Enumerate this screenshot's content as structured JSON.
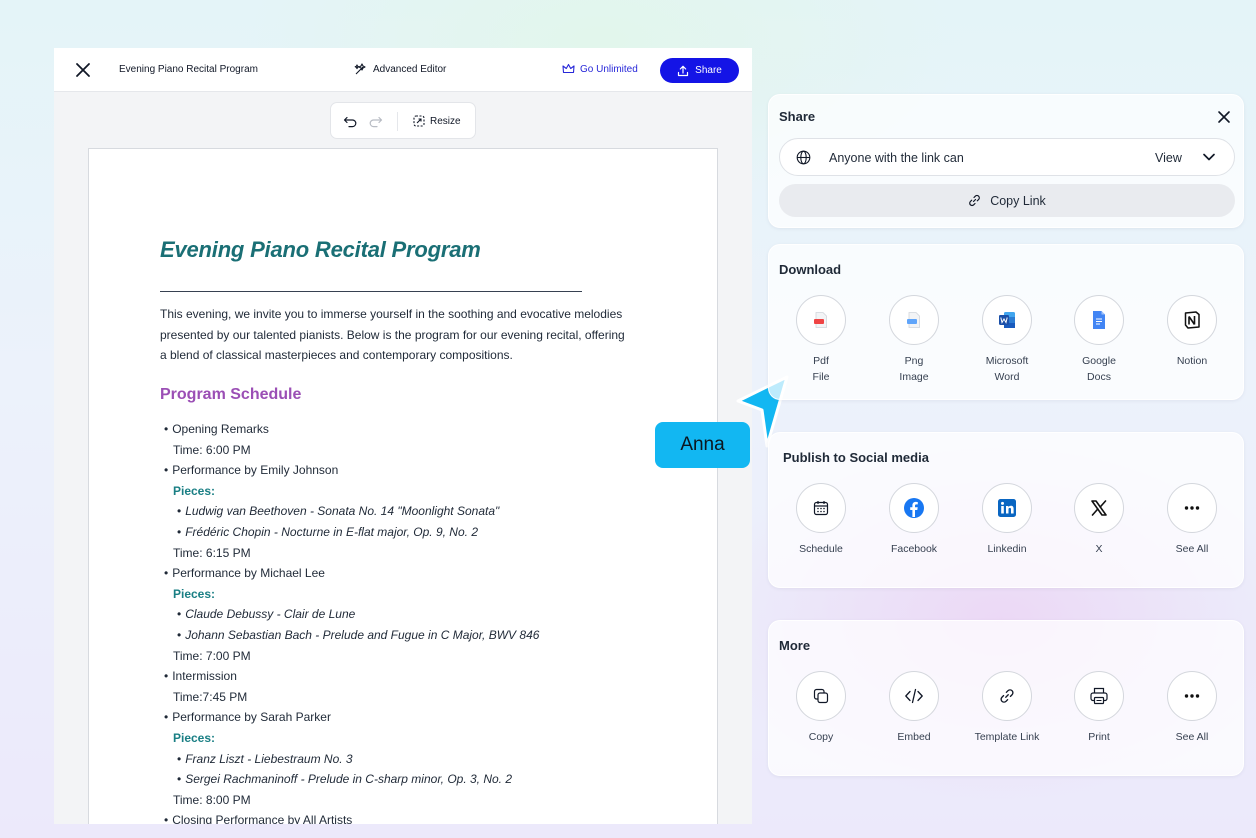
{
  "editor": {
    "doc_name": "Evening Piano Recital Program",
    "advanced_editor_label": "Advanced Editor",
    "go_unlimited_label": "Go Unlimited",
    "share_label": "Share",
    "resize_label": "Resize",
    "accent_color": "#1414e6"
  },
  "document": {
    "title": "Evening Piano Recital Program",
    "intro_lines": [
      "This evening, we invite you to immerse yourself in the soothing and evocative melodies",
      "presented by our talented pianists. Below is the program for our evening recital, offering",
      "a blend of classical masterpieces and contemporary compositions."
    ],
    "schedule_heading": "Program Schedule",
    "schedule": [
      {
        "kind": "b1",
        "text": "Opening Remarks"
      },
      {
        "kind": "t1",
        "text": "Time: 6:00 PM"
      },
      {
        "kind": "b1",
        "text": "Performance by Emily Johnson"
      },
      {
        "kind": "pcs",
        "text": "Pieces:"
      },
      {
        "kind": "b2",
        "text": "Ludwig van Beethoven - Sonata No. 14 \"Moonlight Sonata\""
      },
      {
        "kind": "b2",
        "text": "Frédéric Chopin - Nocturne in E-flat major, Op. 9, No. 2"
      },
      {
        "kind": "t1",
        "text": "Time: 6:15 PM"
      },
      {
        "kind": "b1",
        "text": "Performance by Michael Lee"
      },
      {
        "kind": "pcs",
        "text": "Pieces:"
      },
      {
        "kind": "b2",
        "text": "Claude Debussy - Clair de Lune"
      },
      {
        "kind": "b2",
        "text": "Johann Sebastian Bach - Prelude and Fugue in C Major, BWV 846"
      },
      {
        "kind": "t1",
        "text": "Time: 7:00 PM"
      },
      {
        "kind": "b1",
        "text": "Intermission"
      },
      {
        "kind": "t1",
        "text": "Time:7:45 PM"
      },
      {
        "kind": "b1",
        "text": "Performance by Sarah Parker"
      },
      {
        "kind": "pcs",
        "text": "Pieces:"
      },
      {
        "kind": "b2",
        "text": "Franz Liszt - Liebestraum No. 3"
      },
      {
        "kind": "b2",
        "text": "Sergei Rachmaninoff - Prelude in C-sharp minor, Op. 3, No. 2"
      },
      {
        "kind": "t1",
        "text": "Time: 8:00 PM"
      },
      {
        "kind": "b1",
        "text": "Closing Performance by All Artists"
      }
    ],
    "title_color": "#1a6f75",
    "heading_color": "#9b4fb5",
    "pieces_color": "#1a7f84"
  },
  "share_panel": {
    "title": "Share",
    "access_text": "Anyone with the link can",
    "access_level": "View",
    "copy_link_label": "Copy Link"
  },
  "download": {
    "title": "Download",
    "options": [
      {
        "line1": "Pdf",
        "line2": "File",
        "icon": "pdf-file-icon"
      },
      {
        "line1": "Png",
        "line2": "Image",
        "icon": "png-image-icon"
      },
      {
        "line1": "Microsoft",
        "line2": "Word",
        "icon": "microsoft-word-icon"
      },
      {
        "line1": "Google",
        "line2": "Docs",
        "icon": "google-docs-icon"
      },
      {
        "line1": "Notion",
        "line2": "",
        "icon": "notion-icon"
      }
    ]
  },
  "social": {
    "title": "Publish to Social media",
    "options": [
      {
        "label": "Schedule",
        "icon": "calendar-icon"
      },
      {
        "label": "Facebook",
        "icon": "facebook-icon"
      },
      {
        "label": "Linkedin",
        "icon": "linkedin-icon"
      },
      {
        "label": "X",
        "icon": "x-logo-icon"
      },
      {
        "label": "See All",
        "icon": "more-dots-icon"
      }
    ]
  },
  "more": {
    "title": "More",
    "options": [
      {
        "label": "Copy",
        "icon": "copy-icon"
      },
      {
        "label": "Embed",
        "icon": "code-icon"
      },
      {
        "label": "Template Link",
        "icon": "link-icon"
      },
      {
        "label": "Print",
        "icon": "printer-icon"
      },
      {
        "label": "See All",
        "icon": "more-dots-icon"
      }
    ]
  },
  "collaborator": {
    "name": "Anna",
    "color": "#12b7f2"
  }
}
